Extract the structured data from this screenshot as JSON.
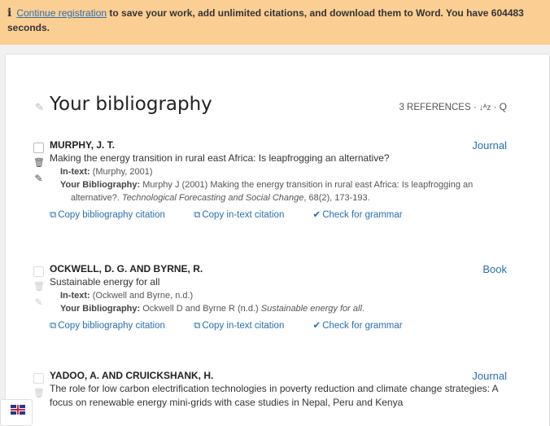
{
  "banner": {
    "info_icon": "i",
    "link": "Continue registration",
    "text_before_seconds": " to save your work, add unlimited citations, and download them to Word. You have ",
    "seconds": "604483",
    "text_after_seconds": " seconds."
  },
  "bibliography": {
    "title": "Your bibliography",
    "count_label": "3 REFERENCES",
    "separator": "·",
    "sort_icon": "↓ᴬz",
    "search_icon": "Q"
  },
  "references": [
    {
      "author": "MURPHY, J. T.",
      "type": "Journal",
      "title": "Making the energy transition in rural east Africa: Is leapfrogging an alternative?",
      "intext_label": "In-text:",
      "intext_value": " (Murphy, 2001)",
      "bib_label": "Your Bibliography:",
      "bib_plain": " Murphy J (2001) Making the energy transition in rural east Africa: Is leapfrogging an alternative?. ",
      "bib_italic": "Technological Forecasting and Social Change",
      "bib_tail": ", 68(2), 173-193.",
      "copy_bib": "Copy bibliography citation",
      "copy_intext": "Copy in-text citation",
      "grammar": "Check for grammar"
    },
    {
      "author": "OCKWELL, D. G. AND BYRNE, R.",
      "type": "Book",
      "title": "Sustainable energy for all",
      "intext_label": "In-text:",
      "intext_value": " (Ockwell and Byrne, n.d.)",
      "bib_label": "Your Bibliography:",
      "bib_plain": " Ockwell D and Byrne R (n.d.) ",
      "bib_italic": "Sustainable energy for all",
      "bib_tail": ".",
      "copy_bib": "Copy bibliography citation",
      "copy_intext": "Copy in-text citation",
      "grammar": "Check for grammar"
    },
    {
      "author": "YADOO, A. AND CRUICKSHANK, H.",
      "type": "Journal",
      "title": "The role for low carbon electrification technologies in poverty reduction and climate change strategies: A focus on renewable energy mini-grids with case studies in Nepal, Peru and Kenya"
    }
  ]
}
